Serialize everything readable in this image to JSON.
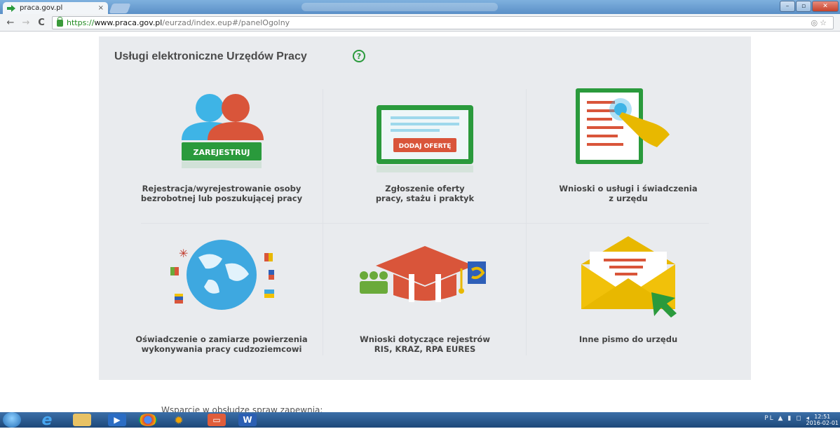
{
  "browser": {
    "tab_title": "praca.gov.pl",
    "tab_close": "×",
    "url_https": "https://",
    "url_host": "www.praca.gov.pl",
    "url_path": "/eurzad/index.eup#/panelOgolny",
    "nav_back": "←",
    "nav_forward": "→",
    "nav_reload": "C",
    "url_actions": "◎☆",
    "win_minimize": "–",
    "win_maximize": "▫",
    "win_close": "✕"
  },
  "page": {
    "title": "Usługi elektroniczne Urzędów Pracy",
    "help_symbol": "?",
    "tiles": [
      {
        "label_line1": "Rejestracja/wyrejestrowanie osoby",
        "label_line2": "bezrobotnej lub poszukującej pracy",
        "button": "ZAREJESTRUJ"
      },
      {
        "label_line1": "Zgłoszenie oferty",
        "label_line2": "pracy, stażu i praktyk",
        "button": "DODAJ OFERTĘ"
      },
      {
        "label_line1": "Wnioski o usługi i świadczenia",
        "label_line2": "z urzędu"
      },
      {
        "label_line1": "Oświadczenie o zamiarze powierzenia",
        "label_line2": "wykonywania pracy cudzoziemcowi"
      },
      {
        "label_line1": "Wnioski dotyczące rejestrów",
        "label_line2": "RIS, KRAZ, RPA EURES",
        "badge": "EURES"
      },
      {
        "label_line1": "Inne pismo do urzędu",
        "label_line2": ""
      }
    ],
    "footer_peek": "Wsparcie w obsłudze spraw zapewnia:"
  },
  "taskbar": {
    "tray_lang": "PL",
    "clock_time": "12:51",
    "clock_date": "2016-02-01"
  },
  "colors": {
    "green": "#2a9a3c",
    "orange_red": "#d9553a",
    "teal": "#41b3b8",
    "yellow": "#e8b800",
    "blue": "#2e9fd8"
  }
}
